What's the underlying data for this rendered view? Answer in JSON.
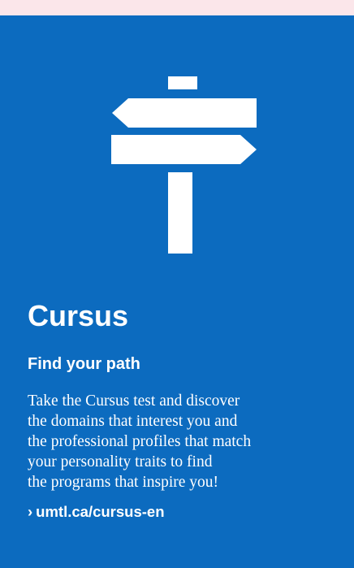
{
  "colors": {
    "background": "#0c6bbf",
    "top_strip": "#fbe6ea",
    "text": "#ffffff"
  },
  "illustration": {
    "icon": "signpost-icon"
  },
  "card": {
    "title": "Cursus",
    "subtitle": "Find your path",
    "description_lines": [
      "Take the Cursus test and discover",
      "the domains that interest you and",
      "the professional profiles that match",
      "your personality traits to find",
      "the programs that inspire you!"
    ],
    "link": {
      "chevron": "›",
      "text": "umtl.ca/cursus-en"
    }
  }
}
